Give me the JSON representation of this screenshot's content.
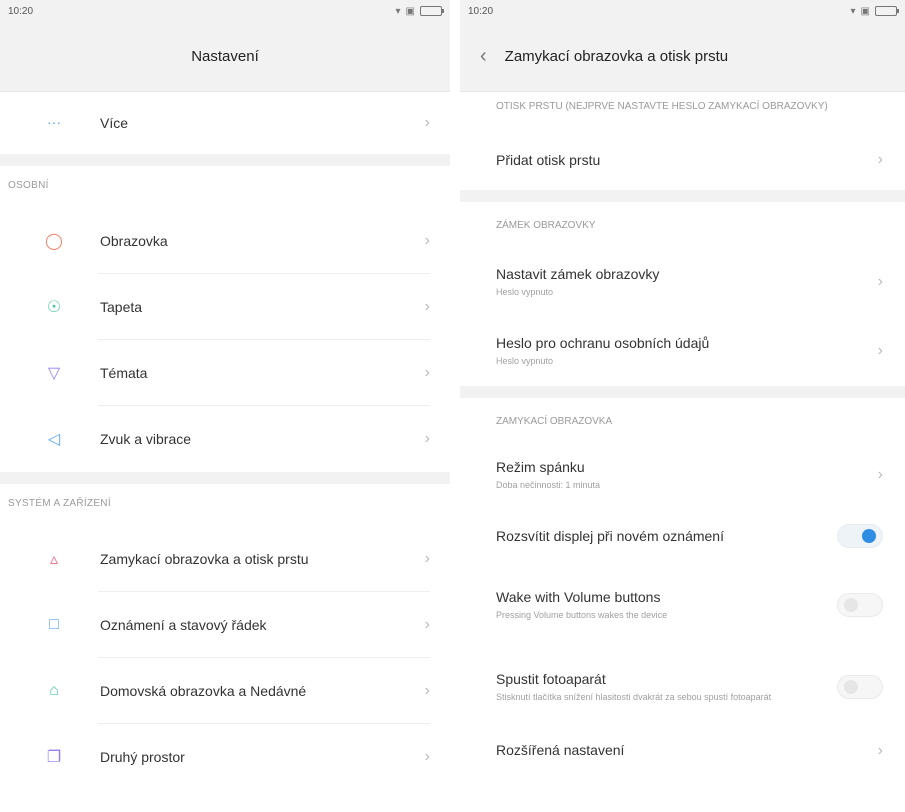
{
  "left": {
    "time": "10:20",
    "title": "Nastavení",
    "more_item": {
      "label": "Více",
      "icon": "dots-icon"
    },
    "section_personal": "OSOBNÍ",
    "personal_items": [
      {
        "label": "Obrazovka",
        "icon": "display-icon",
        "color": "#f4836b"
      },
      {
        "label": "Tapeta",
        "icon": "wallpaper-icon",
        "color": "#4cc8a5"
      },
      {
        "label": "Témata",
        "icon": "themes-icon",
        "color": "#9a7ef0"
      },
      {
        "label": "Zvuk a vibrace",
        "icon": "sound-icon",
        "color": "#5aa6f0"
      }
    ],
    "section_system": "SYSTÉM A ZAŘÍZENÍ",
    "system_items": [
      {
        "label": "Zamykací obrazovka a otisk prstu",
        "icon": "lock-icon",
        "color": "#f06b7e"
      },
      {
        "label": "Oznámení a stavový řádek",
        "icon": "notification-icon",
        "color": "#5aa6f0"
      },
      {
        "label": "Domovská obrazovka a Nedávné",
        "icon": "home-icon",
        "color": "#4cc8a5"
      },
      {
        "label": "Druhý prostor",
        "icon": "second-space-icon",
        "color": "#9a7ef0"
      }
    ]
  },
  "right": {
    "time": "10:20",
    "title": "Zamykací obrazovka a otisk prstu",
    "section_fingerprint": "OTISK PRSTU (NEJPRVE NASTAVTE HESLO ZAMYKACÍ OBRAZOVKY)",
    "add_fingerprint": "Přidat otisk prstu",
    "section_screen_lock": "ZÁMEK OBRAZOVKY",
    "set_lock": {
      "title": "Nastavit zámek obrazovky",
      "sub": "Heslo vypnuto"
    },
    "privacy_pwd": {
      "title": "Heslo pro ochranu osobních údajů",
      "sub": "Heslo vypnuto"
    },
    "section_lockscreen": "ZAMYKACÍ OBRAZOVKA",
    "sleep": {
      "title": "Režim spánku",
      "sub": "Doba nečinnosti: 1 minuta"
    },
    "wake_on_notif": {
      "title": "Rozsvítit displej při novém oznámení",
      "on": true
    },
    "wake_volume": {
      "title": "Wake with Volume buttons",
      "sub": "Pressing Volume buttons wakes the device",
      "on": false
    },
    "camera": {
      "title": "Spustit fotoaparát",
      "sub": "Stisknutí tlačítka snížení hlasitosti dvakrát za sebou spustí fotoaparát",
      "on": false
    },
    "advanced": "Rozšířená nastavení"
  }
}
